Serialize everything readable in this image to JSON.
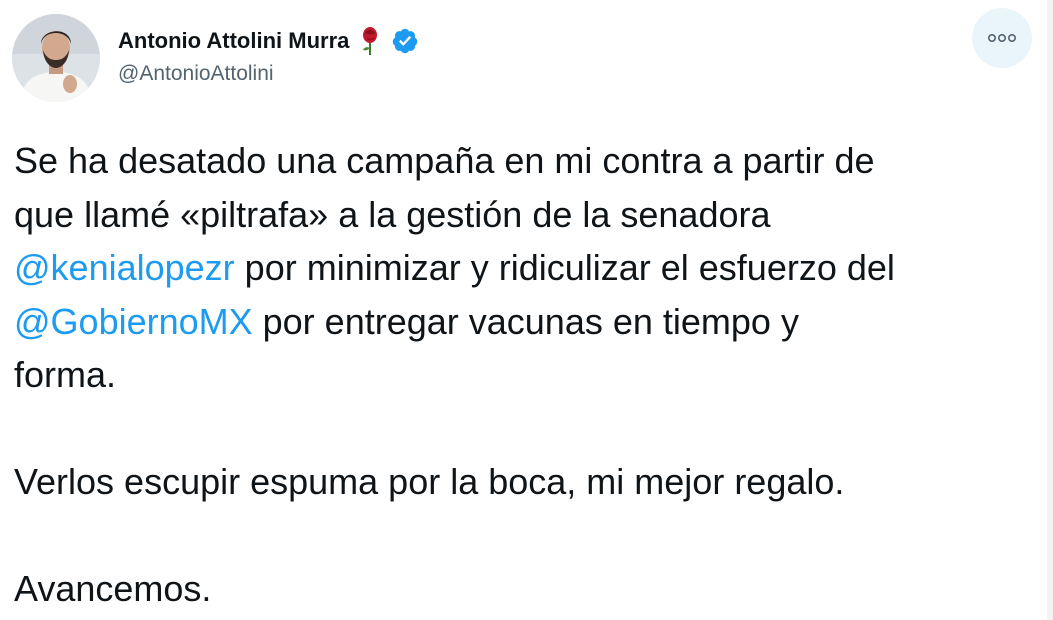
{
  "author": {
    "display_name": "Antonio Attolini Murra",
    "handle": "@AntonioAttolini",
    "avatar_icon": "profile-photo",
    "name_emoji_icon": "rose-icon",
    "verified_icon": "verified-badge-icon"
  },
  "menu": {
    "more_icon": "more-options-icon"
  },
  "tweet": {
    "p1": {
      "line1": "Se ha desatado una campaña en mi contra a partir de",
      "line2": "que llamé «piltrafa» a la gestión de la senadora",
      "mention1": "@kenialopezr",
      "line3_rest": " por minimizar y ridiculizar el esfuerzo del",
      "mention2": "@GobiernoMX",
      "line4_rest": " por entregar vacunas en tiempo y",
      "line5": "forma."
    },
    "p2": "Verlos escupir espuma por la boca, mi mejor regalo.",
    "p3": "Avancemos."
  },
  "colors": {
    "text": "#0f1419",
    "secondary": "#536471",
    "link": "#1d9bf0",
    "verified": "#1d9bf0",
    "more_button_bg": "#eaf4fb"
  }
}
